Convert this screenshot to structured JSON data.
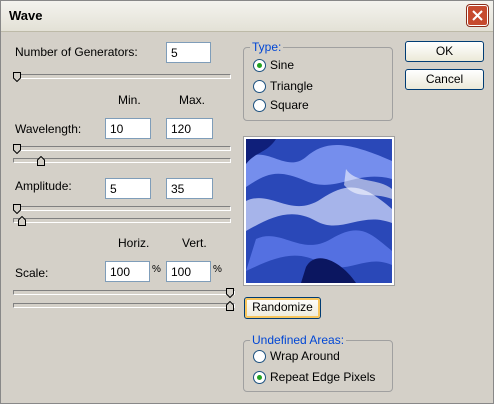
{
  "window": {
    "title": "Wave"
  },
  "generators": {
    "label": "Number of Generators:",
    "value": "5",
    "level": 0.0
  },
  "columns": {
    "min": "Min.",
    "max": "Max.",
    "horiz": "Horiz.",
    "vert": "Vert."
  },
  "wavelength": {
    "label": "Wavelength:",
    "min": "10",
    "max": "120"
  },
  "amplitude": {
    "label": "Amplitude:",
    "min": "5",
    "max": "35"
  },
  "scale": {
    "label": "Scale:",
    "horiz": "100",
    "vert": "100",
    "unit": "%"
  },
  "type_group": {
    "title": "Type:",
    "options": [
      {
        "label": "Sine",
        "selected": true
      },
      {
        "label": "Triangle",
        "selected": false
      },
      {
        "label": "Square",
        "selected": false
      }
    ]
  },
  "buttons": {
    "ok": "OK",
    "cancel": "Cancel",
    "randomize": "Randomize"
  },
  "undefined_areas": {
    "title": "Undefined Areas:",
    "options": [
      {
        "label": "Wrap Around",
        "selected": false
      },
      {
        "label": "Repeat Edge Pixels",
        "selected": true
      }
    ]
  },
  "colors": {
    "accent": "#0046d5",
    "radio_dot": "#21a121",
    "close": "#c64a2e",
    "preview": "#2a48b8"
  }
}
